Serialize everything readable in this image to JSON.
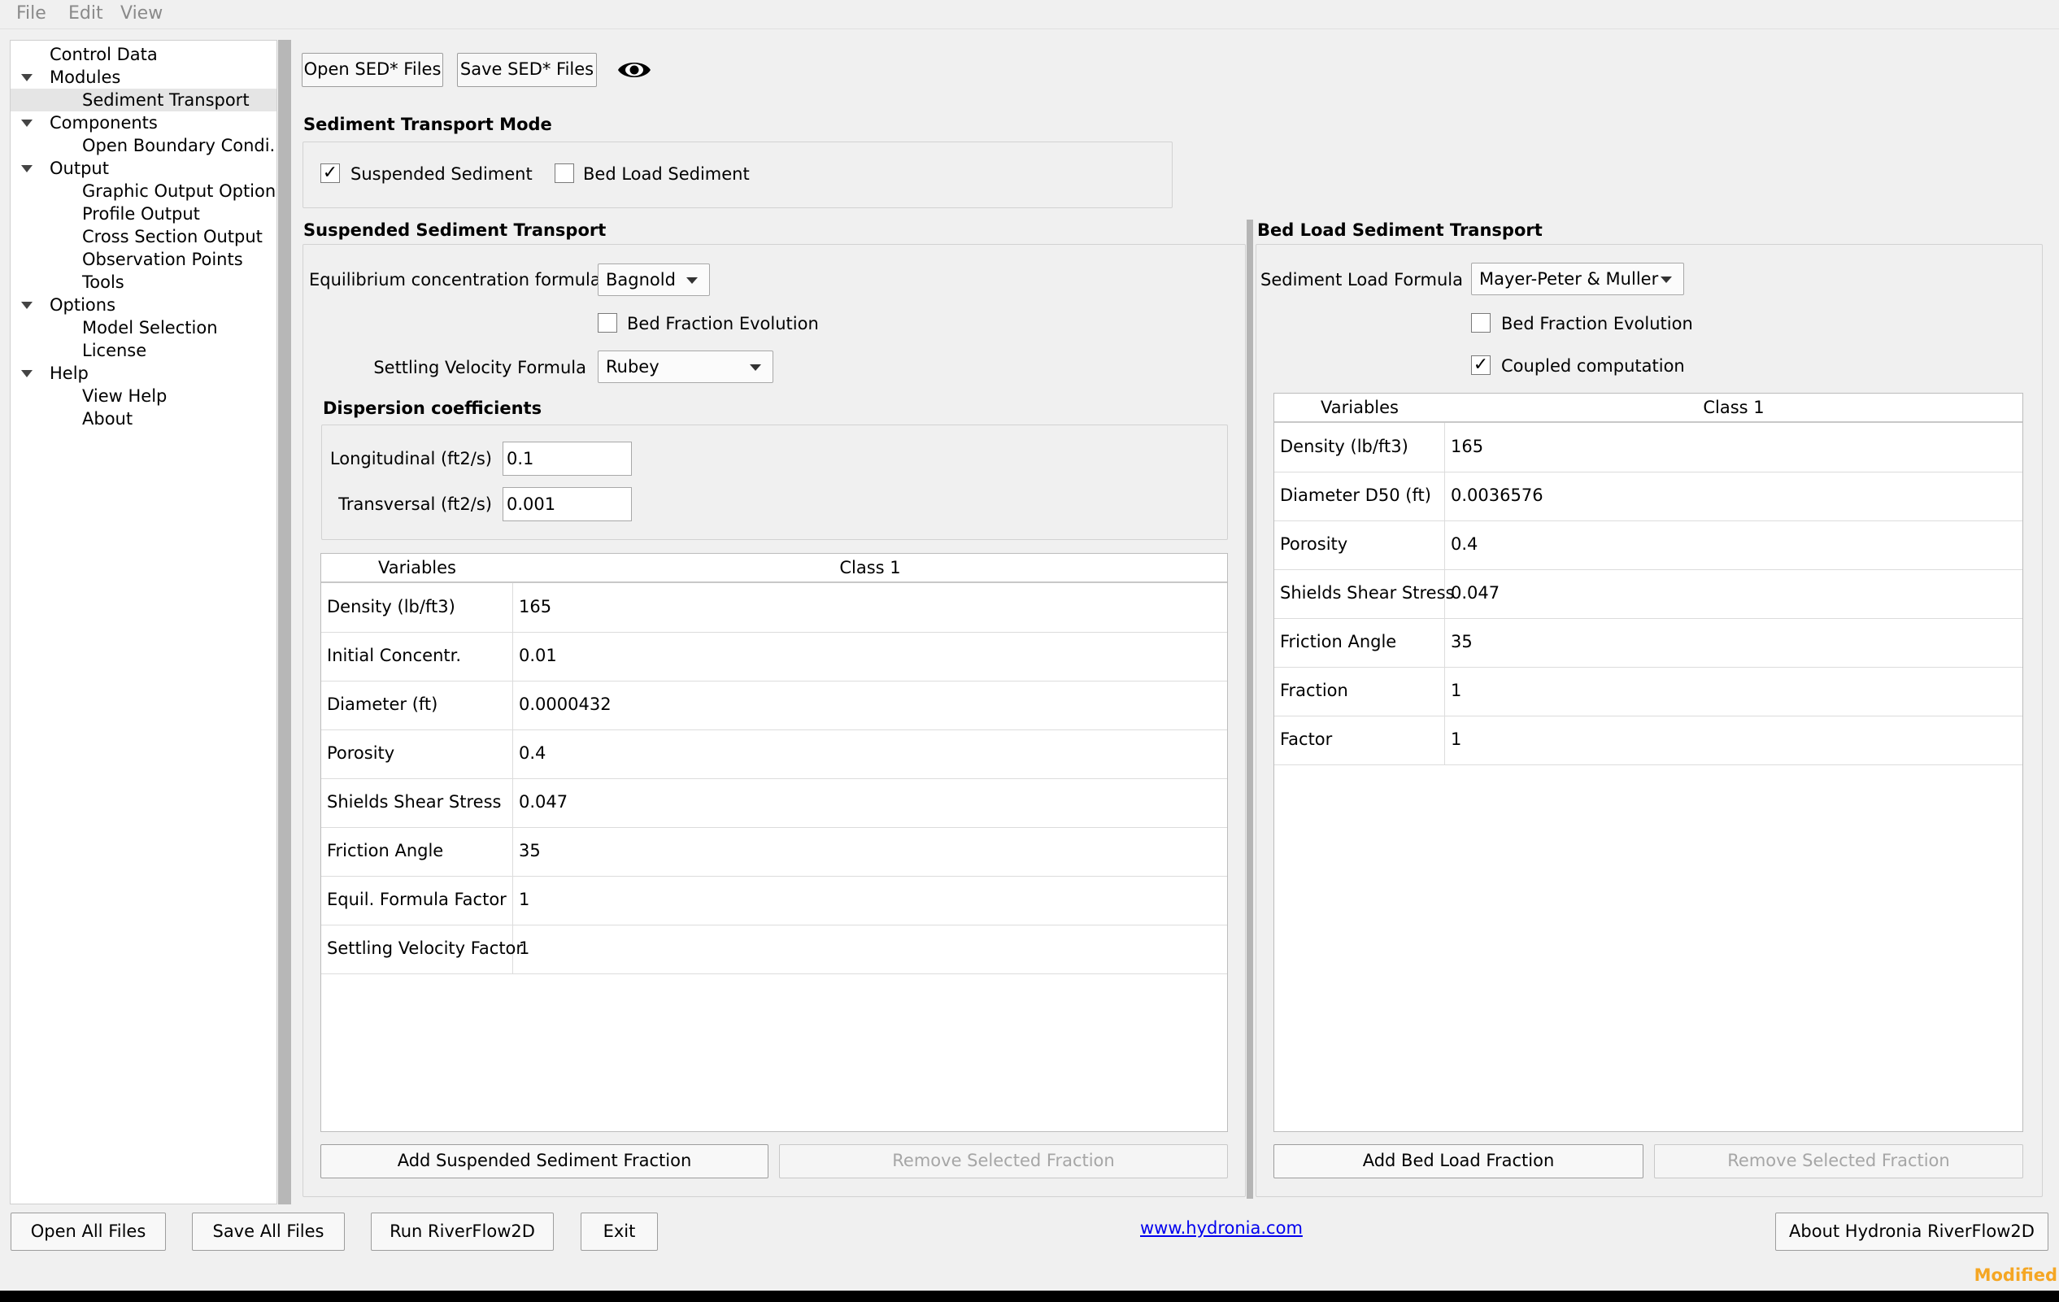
{
  "menu": [
    "File",
    "Edit",
    "View"
  ],
  "tree": [
    {
      "label": "Control Data",
      "level": 0,
      "expander": false
    },
    {
      "label": "Modules",
      "level": 0,
      "expander": true
    },
    {
      "label": "Sediment Transport",
      "level": 1,
      "selected": true
    },
    {
      "label": "Components",
      "level": 0,
      "expander": true
    },
    {
      "label": "Open Boundary Condi...",
      "level": 1
    },
    {
      "label": "Output",
      "level": 0,
      "expander": true
    },
    {
      "label": "Graphic Output Options",
      "level": 1
    },
    {
      "label": "Profile Output",
      "level": 1
    },
    {
      "label": "Cross Section Output",
      "level": 1
    },
    {
      "label": "Observation Points",
      "level": 1
    },
    {
      "label": "Tools",
      "level": 1
    },
    {
      "label": "Options",
      "level": 0,
      "expander": true
    },
    {
      "label": "Model Selection",
      "level": 1
    },
    {
      "label": "License",
      "level": 1
    },
    {
      "label": "Help",
      "level": 0,
      "expander": true
    },
    {
      "label": "View Help",
      "level": 1
    },
    {
      "label": "About",
      "level": 1
    }
  ],
  "toolbar": {
    "open_label": "Open SED* Files",
    "save_label": "Save SED* Files",
    "view_icon": "eye-icon"
  },
  "mode": {
    "title": "Sediment Transport Mode",
    "suspended_label": "Suspended Sediment",
    "suspended_checked": true,
    "bedload_label": "Bed Load Sediment",
    "bedload_checked": false
  },
  "suspended": {
    "title": "Suspended Sediment Transport",
    "eq_label": "Equilibrium concentration formula",
    "eq_value": "Bagnold",
    "bed_fraction_label": "Bed Fraction Evolution",
    "bed_fraction_checked": false,
    "settling_label": "Settling Velocity Formula",
    "settling_value": "Rubey",
    "dispersion_title": "Dispersion coefficients",
    "longitudinal_label": "Longitudinal (ft2/s)",
    "longitudinal_value": "0.1",
    "transversal_label": "Transversal (ft2/s)",
    "transversal_value": "0.001",
    "table": {
      "headers": [
        "Variables",
        "Class 1"
      ],
      "rows": [
        [
          "Density (lb/ft3)",
          "165"
        ],
        [
          "Initial Concentr.",
          "0.01"
        ],
        [
          "Diameter (ft)",
          "0.0000432"
        ],
        [
          "Porosity",
          "0.4"
        ],
        [
          "Shields Shear Stress",
          "0.047"
        ],
        [
          "Friction Angle",
          "35"
        ],
        [
          "Equil. Formula Factor",
          "1"
        ],
        [
          "Settling Velocity Factor",
          "1"
        ]
      ]
    },
    "add_label": "Add Suspended Sediment Fraction",
    "remove_label": "Remove Selected Fraction"
  },
  "bedload": {
    "title": "Bed Load Sediment Transport",
    "formula_label": "Sediment Load Formula",
    "formula_value": "Mayer-Peter & Muller",
    "bed_fraction_label": "Bed Fraction Evolution",
    "bed_fraction_checked": false,
    "coupled_label": "Coupled computation",
    "coupled_checked": true,
    "table": {
      "headers": [
        "Variables",
        "Class 1"
      ],
      "rows": [
        [
          "Density (lb/ft3)",
          "165"
        ],
        [
          "Diameter D50 (ft)",
          "0.0036576"
        ],
        [
          "Porosity",
          "0.4"
        ],
        [
          "Shields Shear Stress",
          "0.047"
        ],
        [
          "Friction Angle",
          "35"
        ],
        [
          "Fraction",
          "1"
        ],
        [
          "Factor",
          "1"
        ]
      ]
    },
    "add_label": "Add Bed Load Fraction",
    "remove_label": "Remove Selected Fraction"
  },
  "footer": {
    "open_all": "Open All Files",
    "save_all": "Save All Files",
    "run": "Run RiverFlow2D",
    "exit": "Exit",
    "link": "www.hydronia.com",
    "about": "About Hydronia RiverFlow2D",
    "status": "Modified"
  },
  "colors": {
    "window_bg": "#f0f0f0",
    "link": "#0000ee",
    "status_modified": "#f5a623",
    "selection": "#e5e5e5"
  }
}
